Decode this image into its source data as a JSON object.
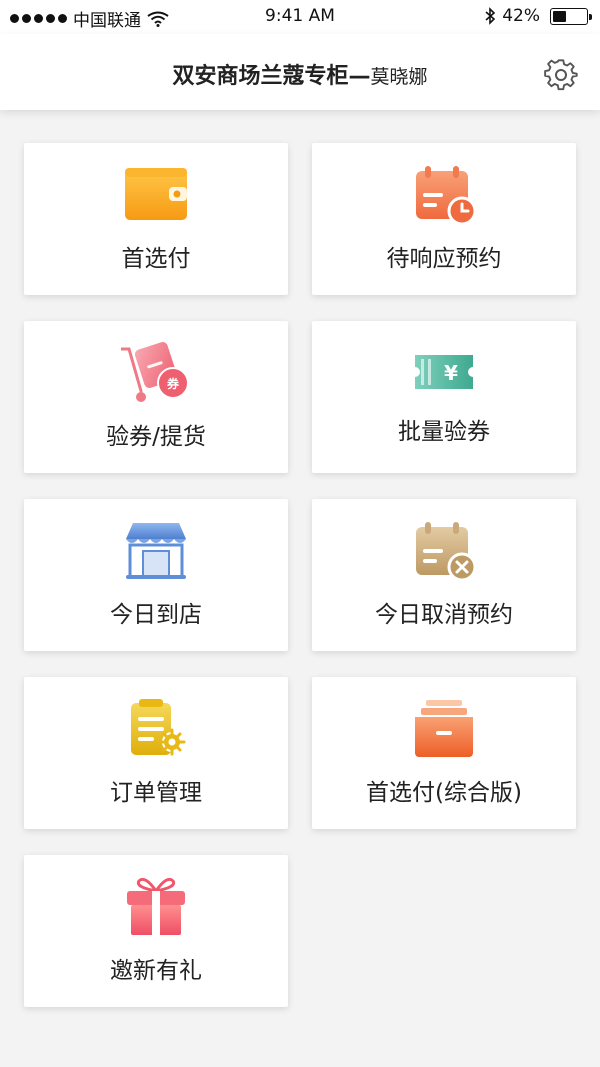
{
  "status_bar": {
    "carrier": "中国联通",
    "time": "9:41 AM",
    "battery_percent": "42%",
    "battery_level": 0.42,
    "icons": [
      "signal-dots-icon",
      "wifi-icon",
      "bluetooth-icon",
      "battery-icon"
    ]
  },
  "header": {
    "store_name": "双安商场兰蔻专柜—",
    "user_name": "莫晓娜",
    "settings_icon": "gear-icon"
  },
  "tiles": [
    {
      "label": "首选付",
      "icon": "wallet-icon",
      "color": "#f7a21c"
    },
    {
      "label": "待响应预约",
      "icon": "calendar-clock-icon",
      "color": "#f27a4f"
    },
    {
      "label": "验券/提货",
      "icon": "cart-voucher-icon",
      "color": "#ef6f7d"
    },
    {
      "label": "批量验券",
      "icon": "yuan-ticket-icon",
      "color": "#4fb7a0"
    },
    {
      "label": "今日到店",
      "icon": "storefront-icon",
      "color": "#5e8fd6"
    },
    {
      "label": "今日取消预约",
      "icon": "calendar-cancel-icon",
      "color": "#c9a97a"
    },
    {
      "label": "订单管理",
      "icon": "clipboard-gear-icon",
      "color": "#e8b914"
    },
    {
      "label": "首选付(综合版)",
      "icon": "drawer-icon",
      "color": "#f06b34"
    },
    {
      "label": "邀新有礼",
      "icon": "gift-icon",
      "color": "#f2566a"
    }
  ]
}
